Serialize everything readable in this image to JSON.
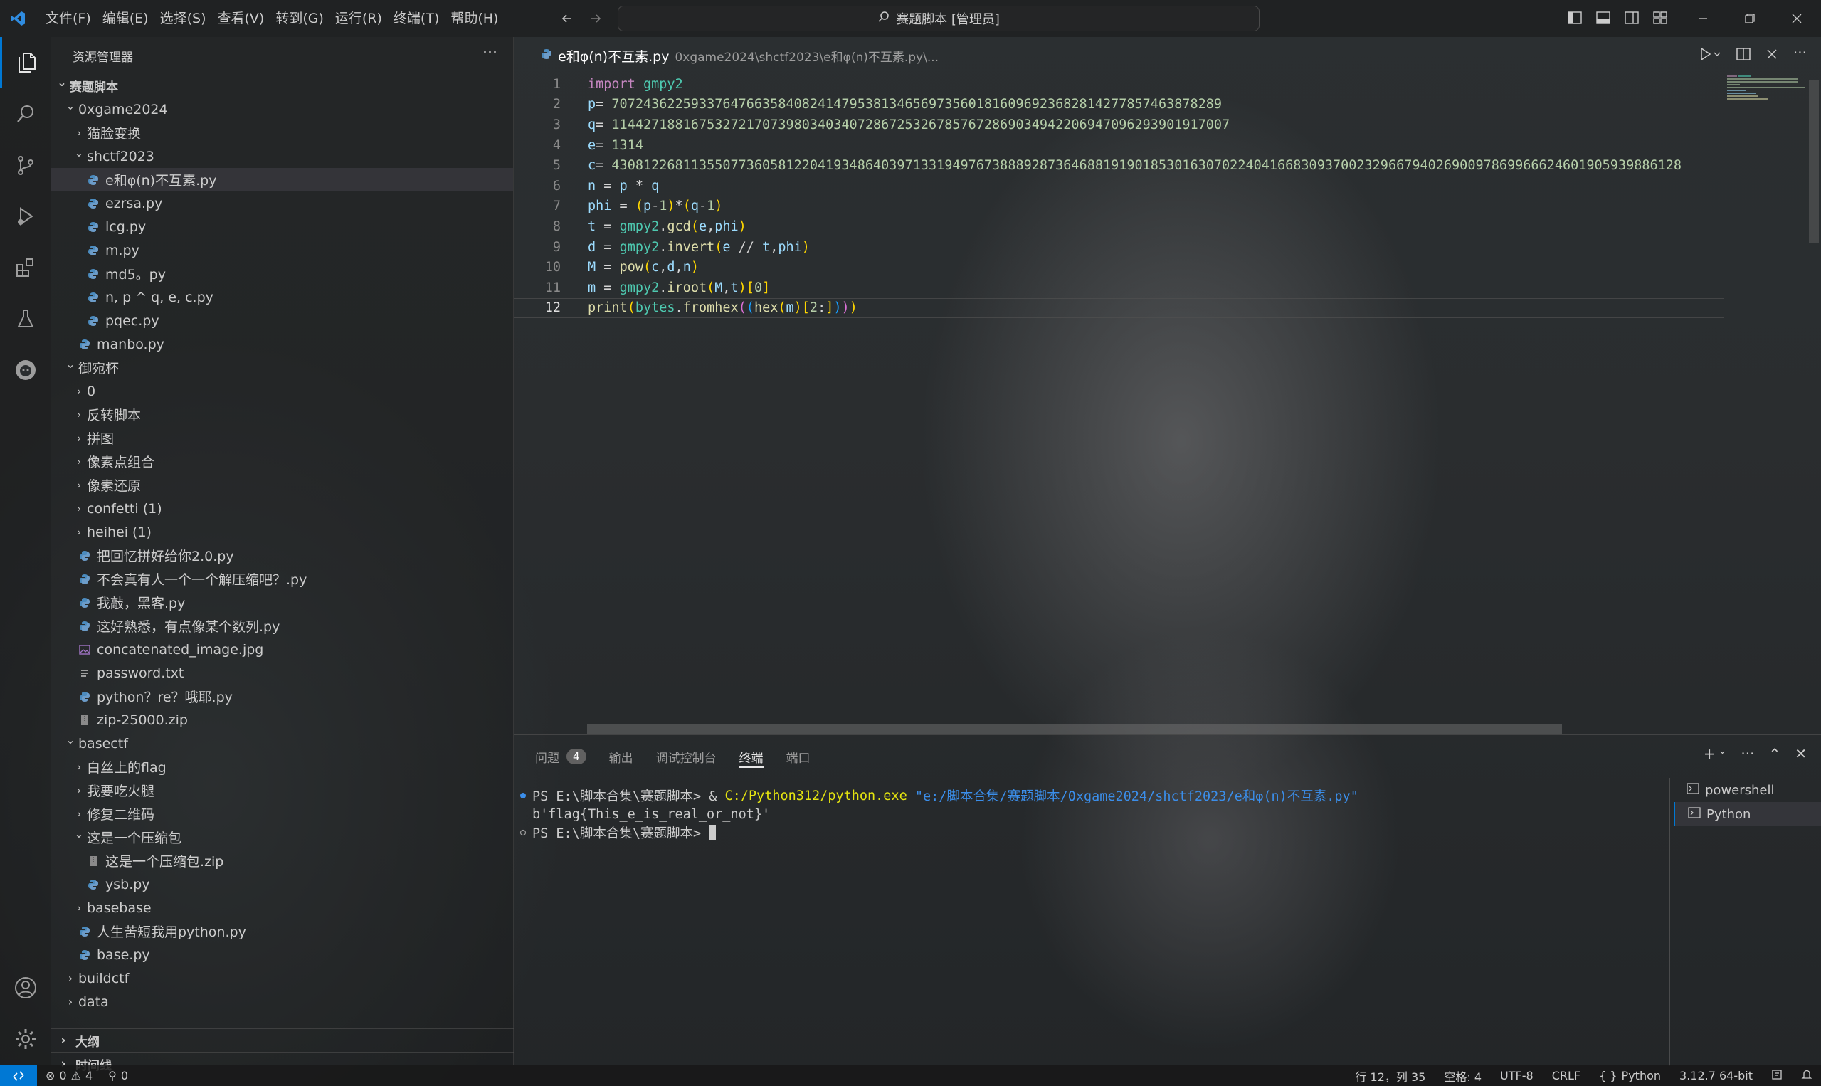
{
  "menu": [
    "文件(F)",
    "编辑(E)",
    "选择(S)",
    "查看(V)",
    "转到(G)",
    "运行(R)",
    "终端(T)",
    "帮助(H)"
  ],
  "search_title": "赛题脚本 [管理员]",
  "sidebar": {
    "title": "资源管理器",
    "tree": [
      {
        "label": "赛题脚本",
        "depth": 0,
        "type": "folder-open",
        "root": true
      },
      {
        "label": "0xgame2024",
        "depth": 1,
        "type": "folder-open"
      },
      {
        "label": "猫脸变换",
        "depth": 2,
        "type": "folder"
      },
      {
        "label": "shctf2023",
        "depth": 2,
        "type": "folder-open"
      },
      {
        "label": "e和φ(n)不互素.py",
        "depth": 3,
        "type": "py",
        "selected": true
      },
      {
        "label": "ezrsa.py",
        "depth": 3,
        "type": "py"
      },
      {
        "label": "lcg.py",
        "depth": 3,
        "type": "py"
      },
      {
        "label": "m.py",
        "depth": 3,
        "type": "py"
      },
      {
        "label": "md5。py",
        "depth": 3,
        "type": "py"
      },
      {
        "label": "n, p ^ q, e, c.py",
        "depth": 3,
        "type": "py"
      },
      {
        "label": "pqec.py",
        "depth": 3,
        "type": "py"
      },
      {
        "label": "manbo.py",
        "depth": 2,
        "type": "py"
      },
      {
        "label": "御宛杯",
        "depth": 1,
        "type": "folder-open"
      },
      {
        "label": "0",
        "depth": 2,
        "type": "folder"
      },
      {
        "label": "反转脚本",
        "depth": 2,
        "type": "folder"
      },
      {
        "label": "拼图",
        "depth": 2,
        "type": "folder"
      },
      {
        "label": "像素点组合",
        "depth": 2,
        "type": "folder"
      },
      {
        "label": "像素还原",
        "depth": 2,
        "type": "folder"
      },
      {
        "label": "confetti (1)",
        "depth": 2,
        "type": "folder"
      },
      {
        "label": "heihei (1)",
        "depth": 2,
        "type": "folder"
      },
      {
        "label": "把回忆拼好给你2.0.py",
        "depth": 2,
        "type": "py"
      },
      {
        "label": "不会真有人一个一个解压缩吧？.py",
        "depth": 2,
        "type": "py"
      },
      {
        "label": "我敲，黑客.py",
        "depth": 2,
        "type": "py"
      },
      {
        "label": "这好熟悉，有点像某个数列.py",
        "depth": 2,
        "type": "py"
      },
      {
        "label": "concatenated_image.jpg",
        "depth": 2,
        "type": "img"
      },
      {
        "label": "password.txt",
        "depth": 2,
        "type": "txt"
      },
      {
        "label": "python？re？哦耶.py",
        "depth": 2,
        "type": "py"
      },
      {
        "label": "zip-25000.zip",
        "depth": 2,
        "type": "zip"
      },
      {
        "label": "basectf",
        "depth": 1,
        "type": "folder-open"
      },
      {
        "label": "白丝上的flag",
        "depth": 2,
        "type": "folder"
      },
      {
        "label": "我要吃火腿",
        "depth": 2,
        "type": "folder"
      },
      {
        "label": "修复二维码",
        "depth": 2,
        "type": "folder"
      },
      {
        "label": "这是一个压缩包",
        "depth": 2,
        "type": "folder-open"
      },
      {
        "label": "这是一个压缩包.zip",
        "depth": 3,
        "type": "zip"
      },
      {
        "label": "ysb.py",
        "depth": 3,
        "type": "py"
      },
      {
        "label": "basebase",
        "depth": 2,
        "type": "folder"
      },
      {
        "label": "人生苦短我用python.py",
        "depth": 2,
        "type": "py"
      },
      {
        "label": "base.py",
        "depth": 2,
        "type": "py"
      },
      {
        "label": "buildctf",
        "depth": 1,
        "type": "folder"
      },
      {
        "label": "data",
        "depth": 1,
        "type": "folder"
      }
    ],
    "sections": [
      "大纲",
      "时间线"
    ]
  },
  "editor": {
    "tab_name": "e和φ(n)不互素.py",
    "tab_path": "0xgame2024\\shctf2023\\e和φ(n)不互素.py\\...",
    "current_line": 12,
    "lines": [
      {
        "n": 1,
        "tokens": [
          [
            "kw",
            "import "
          ],
          [
            "mod",
            "gmpy2"
          ]
        ]
      },
      {
        "n": 2,
        "tokens": [
          [
            "var",
            "p"
          ],
          [
            "",
            "= "
          ],
          [
            "num",
            "7072436225933764766358408241479538134656973560181609692368281427785746387828"
          ],
          [
            "num",
            "9"
          ]
        ]
      },
      {
        "n": 3,
        "tokens": [
          [
            "var",
            "q"
          ],
          [
            "",
            "= "
          ],
          [
            "num",
            "11442718816753272170739803403407286725326785767286903494220694709629390191700"
          ],
          [
            "num",
            "7"
          ]
        ]
      },
      {
        "n": 4,
        "tokens": [
          [
            "var",
            "e"
          ],
          [
            "",
            "= "
          ],
          [
            "num",
            "1314"
          ]
        ]
      },
      {
        "n": 5,
        "tokens": [
          [
            "var",
            "c"
          ],
          [
            "",
            "= "
          ],
          [
            "num",
            "430812268113550773605812204193486403971331949767388892873646881919018530163070224041668309370023296679402690097869966624601905939886128"
          ]
        ]
      },
      {
        "n": 6,
        "tokens": [
          [
            "var",
            "n"
          ],
          [
            "",
            " = "
          ],
          [
            "var",
            "p"
          ],
          [
            "",
            " * "
          ],
          [
            "var",
            "q"
          ]
        ]
      },
      {
        "n": 7,
        "tokens": [
          [
            "var",
            "phi"
          ],
          [
            "",
            " = "
          ],
          [
            "br1",
            "("
          ],
          [
            "var",
            "p"
          ],
          [
            "",
            "-"
          ],
          [
            "num",
            "1"
          ],
          [
            "br1",
            ")"
          ],
          [
            "",
            "*"
          ],
          [
            "br1",
            "("
          ],
          [
            "var",
            "q"
          ],
          [
            "",
            "-"
          ],
          [
            "num",
            "1"
          ],
          [
            "br1",
            ")"
          ]
        ]
      },
      {
        "n": 8,
        "tokens": [
          [
            "var",
            "t"
          ],
          [
            "",
            " = "
          ],
          [
            "mod",
            "gmpy2"
          ],
          [
            "",
            "."
          ],
          [
            "fn",
            "gcd"
          ],
          [
            "br1",
            "("
          ],
          [
            "var",
            "e"
          ],
          [
            "",
            ","
          ],
          [
            "var",
            "phi"
          ],
          [
            "br1",
            ")"
          ]
        ]
      },
      {
        "n": 9,
        "tokens": [
          [
            "var",
            "d"
          ],
          [
            "",
            " = "
          ],
          [
            "mod",
            "gmpy2"
          ],
          [
            "",
            "."
          ],
          [
            "fn",
            "invert"
          ],
          [
            "br1",
            "("
          ],
          [
            "var",
            "e"
          ],
          [
            "",
            " // "
          ],
          [
            "var",
            "t"
          ],
          [
            "",
            ","
          ],
          [
            "var",
            "phi"
          ],
          [
            "br1",
            ")"
          ]
        ]
      },
      {
        "n": 10,
        "tokens": [
          [
            "var",
            "M"
          ],
          [
            "",
            " = "
          ],
          [
            "fn",
            "pow"
          ],
          [
            "br1",
            "("
          ],
          [
            "var",
            "c"
          ],
          [
            "",
            ","
          ],
          [
            "var",
            "d"
          ],
          [
            "",
            ","
          ],
          [
            "var",
            "n"
          ],
          [
            "br1",
            ")"
          ]
        ]
      },
      {
        "n": 11,
        "tokens": [
          [
            "var",
            "m"
          ],
          [
            "",
            " = "
          ],
          [
            "mod",
            "gmpy2"
          ],
          [
            "",
            "."
          ],
          [
            "fn",
            "iroot"
          ],
          [
            "br1",
            "("
          ],
          [
            "var",
            "M"
          ],
          [
            "",
            ","
          ],
          [
            "var",
            "t"
          ],
          [
            "br1",
            ")"
          ],
          [
            "br1",
            "["
          ],
          [
            "num",
            "0"
          ],
          [
            "br1",
            "]"
          ]
        ]
      },
      {
        "n": 12,
        "tokens": [
          [
            "fn",
            "print"
          ],
          [
            "br1",
            "("
          ],
          [
            "mod",
            "bytes"
          ],
          [
            "",
            "."
          ],
          [
            "fn",
            "fromhex"
          ],
          [
            "br2",
            "("
          ],
          [
            "br3",
            "("
          ],
          [
            "fn",
            "hex"
          ],
          [
            "br1",
            "("
          ],
          [
            "var",
            "m"
          ],
          [
            "br1",
            ")"
          ],
          [
            "br1",
            "["
          ],
          [
            "num",
            "2"
          ],
          [
            "",
            ":"
          ],
          [
            "br1",
            "]"
          ],
          [
            "br3",
            ")"
          ],
          [
            "br2",
            ")"
          ],
          [
            "br1",
            ")"
          ]
        ]
      }
    ]
  },
  "panel": {
    "tabs": [
      "问题",
      "输出",
      "调试控制台",
      "终端",
      "端口"
    ],
    "problems_count": "4",
    "active_tab": "终端",
    "terminal": {
      "line1_prompt": "PS E:\\脚本合集\\赛题脚本> & ",
      "line1_exe": "C:/Python312/python.exe",
      "line1_arg": "\"e:/脚本合集/赛题脚本/0xgame2024/shctf2023/e和φ(n)不互素.py\"",
      "line2": "b'flag{This_e_is_real_or_not}'",
      "line3": "PS E:\\脚本合集\\赛题脚本> "
    },
    "terminals": [
      "powershell",
      "Python"
    ]
  },
  "status": {
    "errors": "0",
    "warnings": "4",
    "ports": "0",
    "position": "行 12，列 35",
    "spaces": "空格: 4",
    "encoding": "UTF-8",
    "eol": "CRLF",
    "language": "Python",
    "interpreter": "3.12.7 64-bit"
  },
  "colors": {
    "accent": "#0078d4",
    "remote": "#0078d4"
  }
}
